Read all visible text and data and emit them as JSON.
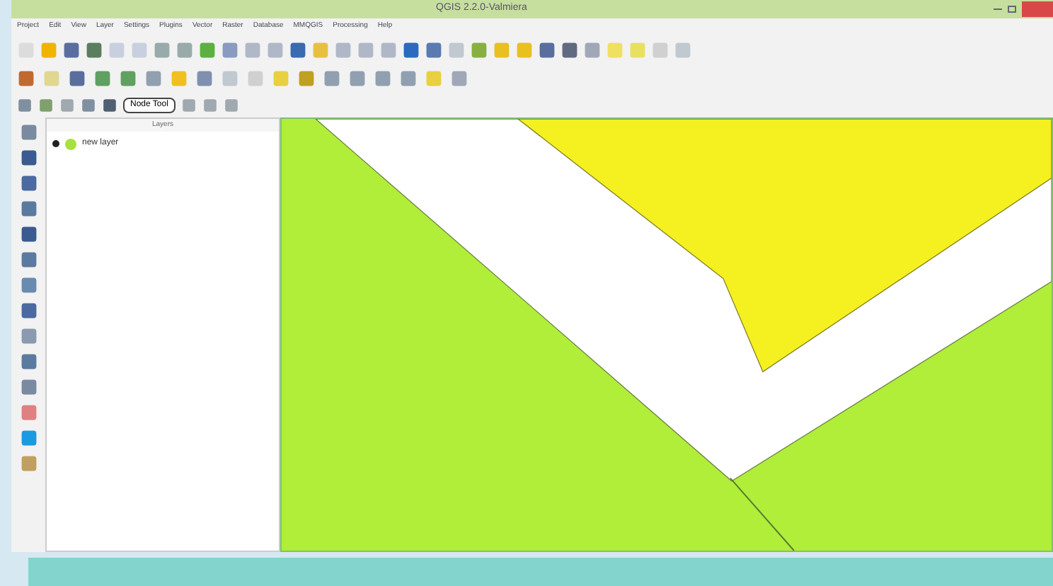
{
  "window": {
    "title": "QGIS 2.2.0-Valmiera"
  },
  "menu": [
    "Project",
    "Edit",
    "View",
    "Layer",
    "Settings",
    "Plugins",
    "Vector",
    "Raster",
    "Database",
    "MMQGIS",
    "Processing",
    "Help"
  ],
  "tooltip": "Node Tool",
  "layers_panel": {
    "title": "Layers",
    "layers": [
      {
        "name": "new layer",
        "checked": true
      }
    ]
  }
}
